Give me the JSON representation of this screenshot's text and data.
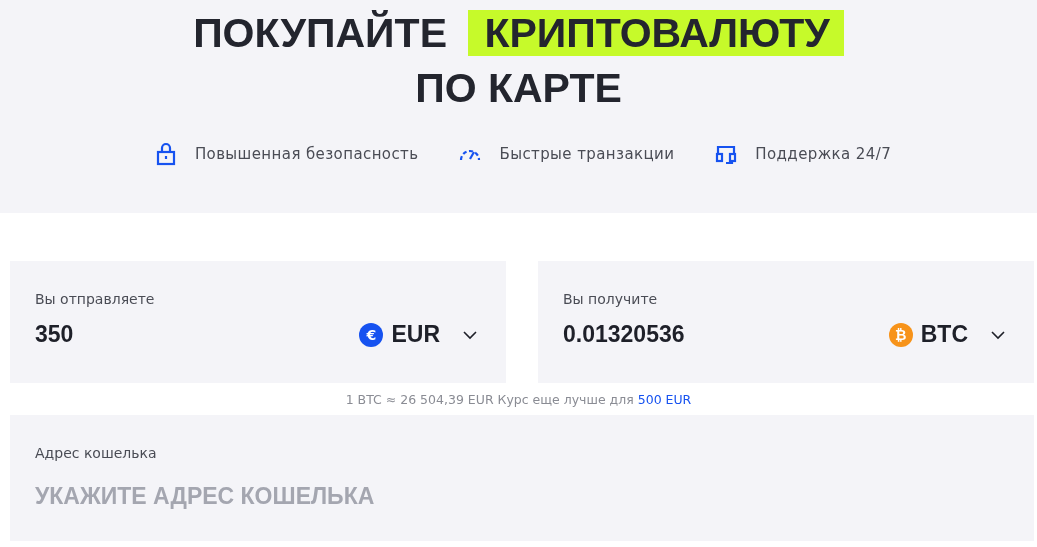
{
  "title": {
    "line1": [
      {
        "text": "ПОКУПАЙТЕ",
        "highlighted": false
      },
      {
        "text": "КРИПТОВАЛЮТУ",
        "highlighted": true
      }
    ],
    "line2": "ПО КАРТЕ"
  },
  "features": [
    {
      "kind": "lock",
      "label": "Повышенная безопасность"
    },
    {
      "kind": "speed",
      "label": "Быстрые транзакции"
    },
    {
      "kind": "support",
      "label": "Поддержка 24/7"
    }
  ],
  "exchange": [
    {
      "label": "Вы отправляете",
      "amount": "350",
      "currency": "EUR",
      "coin_glyph": "€",
      "color": "#1652f0"
    },
    {
      "label": "Вы получите",
      "amount": "0.01320536",
      "currency": "BTC",
      "coin_glyph": "₿",
      "color": "#f7931a"
    }
  ],
  "rate": {
    "text": "1 BTC ≈ 26 504,39 EUR Курс еще лучше для",
    "link": "500 EUR"
  },
  "wallet": {
    "label": "Адрес кошелька",
    "placeholder": "УКАЖИТЕ АДРЕС КОШЕЛЬКА"
  }
}
